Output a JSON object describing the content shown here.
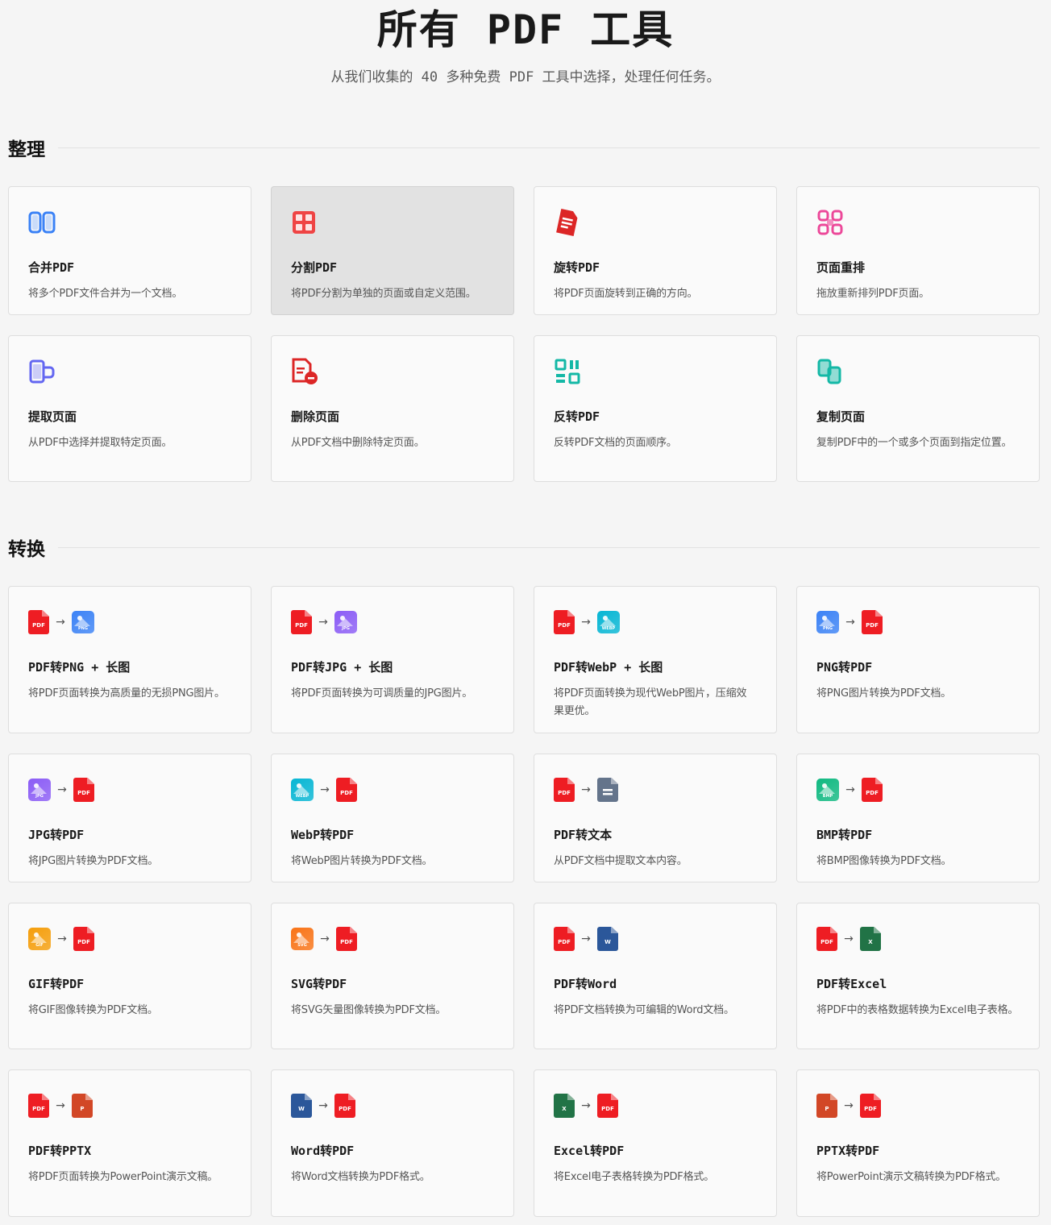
{
  "header": {
    "title": "所有 PDF 工具",
    "subtitle": "从我们收集的 40 多种免费 PDF 工具中选择，处理任何任务。"
  },
  "sections": [
    {
      "title": "整理",
      "tools": [
        {
          "name": "合并PDF",
          "desc": "将多个PDF文件合并为一个文档。",
          "icon": "merge-icon",
          "color": "#3b82f6"
        },
        {
          "name": "分割PDF",
          "desc": "将PDF分割为单独的页面或自定义范围。",
          "icon": "split-icon",
          "color": "#ef4444",
          "hover": true
        },
        {
          "name": "旋转PDF",
          "desc": "将PDF页面旋转到正确的方向。",
          "icon": "rotate-icon",
          "color": "#dc2626"
        },
        {
          "name": "页面重排",
          "desc": "拖放重新排列PDF页面。",
          "icon": "reorder-icon",
          "color": "#ec4899"
        },
        {
          "name": "提取页面",
          "desc": "从PDF中选择并提取特定页面。",
          "icon": "extract-icon",
          "color": "#6366f1"
        },
        {
          "name": "删除页面",
          "desc": "从PDF文档中删除特定页面。",
          "icon": "delete-page-icon",
          "color": "#dc2626"
        },
        {
          "name": "反转PDF",
          "desc": "反转PDF文档的页面顺序。",
          "icon": "reverse-icon",
          "color": "#14b8a6"
        },
        {
          "name": "复制页面",
          "desc": "复制PDF中的一个或多个页面到指定位置。",
          "icon": "duplicate-icon",
          "color": "#14b8a6"
        }
      ]
    },
    {
      "title": "转换",
      "tools": [
        {
          "name": "PDF转PNG + 长图",
          "desc": "将PDF页面转换为高质量的无损PNG图片。",
          "from": "PDF",
          "to": "PNG"
        },
        {
          "name": "PDF转JPG + 长图",
          "desc": "将PDF页面转换为可调质量的JPG图片。",
          "from": "PDF",
          "to": "JPG"
        },
        {
          "name": "PDF转WebP + 长图",
          "desc": "将PDF页面转换为现代WebP图片，压缩效果更优。",
          "from": "PDF",
          "to": "WEBP"
        },
        {
          "name": "PNG转PDF",
          "desc": "将PNG图片转换为PDF文档。",
          "from": "PNG",
          "to": "PDF"
        },
        {
          "name": "JPG转PDF",
          "desc": "将JPG图片转换为PDF文档。",
          "from": "JPG",
          "to": "PDF"
        },
        {
          "name": "WebP转PDF",
          "desc": "将WebP图片转换为PDF文档。",
          "from": "WEBP",
          "to": "PDF"
        },
        {
          "name": "PDF转文本",
          "desc": "从PDF文档中提取文本内容。",
          "from": "PDF",
          "to": "TXT"
        },
        {
          "name": "BMP转PDF",
          "desc": "将BMP图像转换为PDF文档。",
          "from": "BMP",
          "to": "PDF"
        },
        {
          "name": "GIF转PDF",
          "desc": "将GIF图像转换为PDF文档。",
          "from": "GIF",
          "to": "PDF"
        },
        {
          "name": "SVG转PDF",
          "desc": "将SVG矢量图像转换为PDF文档。",
          "from": "SVG",
          "to": "PDF"
        },
        {
          "name": "PDF转Word",
          "desc": "将PDF文档转换为可编辑的Word文档。",
          "from": "PDF",
          "to": "W"
        },
        {
          "name": "PDF转Excel",
          "desc": "将PDF中的表格数据转换为Excel电子表格。",
          "from": "PDF",
          "to": "X"
        },
        {
          "name": "PDF转PPTX",
          "desc": "将PDF页面转换为PowerPoint演示文稿。",
          "from": "PDF",
          "to": "P"
        },
        {
          "name": "Word转PDF",
          "desc": "将Word文档转换为PDF格式。",
          "from": "W",
          "to": "PDF"
        },
        {
          "name": "Excel转PDF",
          "desc": "将Excel电子表格转换为PDF格式。",
          "from": "X",
          "to": "PDF"
        },
        {
          "name": "PPTX转PDF",
          "desc": "将PowerPoint演示文稿转换为PDF格式。",
          "from": "P",
          "to": "PDF"
        }
      ]
    }
  ],
  "format_colors": {
    "PDF": "#ee1d23",
    "PNG": "#3b82f6",
    "JPG": "#8b5cf6",
    "WEBP": "#06b6d4",
    "BMP": "#10b981",
    "GIF": "#f59e0b",
    "SVG": "#f97316",
    "TXT": "#64748b",
    "W": "#2b579a",
    "X": "#217346",
    "P": "#d24726"
  }
}
